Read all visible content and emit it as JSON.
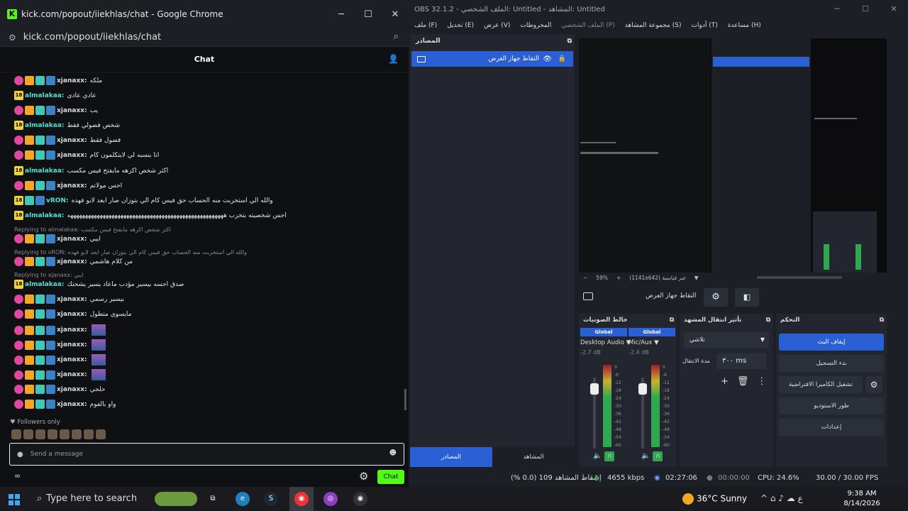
{
  "chrome": {
    "title": "kick.com/popout/iiekhlas/chat - Google Chrome",
    "url": "kick.com/popout/iiekhlas/chat",
    "chat_title": "Chat",
    "followers_only": "Followers only",
    "send_placeholder": "Send a message",
    "infinity": "∞",
    "chat_button": "Chat",
    "icons": {
      "logo": "kick-logo-icon",
      "minimize": "minimize-icon",
      "maximize": "maximize-icon",
      "close": "close-icon",
      "tune": "site-settings-icon",
      "zoom": "zoom-icon",
      "users": "user-list-icon",
      "gear": "gear-icon",
      "emoji": "emoji-icon"
    }
  },
  "messages": [
    {
      "user": "xjanaxx",
      "text": "ملكه"
    },
    {
      "user": "almalakaa",
      "text": "عادي عادي"
    },
    {
      "user": "xjanaxx",
      "text": "يب"
    },
    {
      "user": "almalakaa",
      "text": "شخص فضولي فقط"
    },
    {
      "user": "xjanaxx",
      "text": "فضول فقط"
    },
    {
      "user": "xjanaxx",
      "text": "انا بنسبه لي لايتكلمون كام"
    },
    {
      "user": "almalakaa",
      "text": "اكثر شخص اكرهه مايفتح فيس مكسب"
    },
    {
      "user": "xjanaxx",
      "text": "احس مولاتم"
    },
    {
      "user": "vRON",
      "text": "والله الي استخربت منه الحساب حق فيس كام الي بتوزان صار ابعد لابو فهده"
    },
    {
      "user": "almalakaa",
      "text": "احس شخصيته بتخرب هههههههههههههههههههههههههههههههههههههههههههههههههههههه"
    },
    {
      "reply": "Replying to almalakaa: اكثر شخص اكرهه مايفتح فيس مكسب",
      "user": "xjanaxx",
      "text": "ايبي"
    },
    {
      "reply": "Replying to vRON: والله الي استخربت منه الحساب حق فيس كام الي بتوزان صار ابعد لابو فهده",
      "user": "xjanaxx",
      "text": "من كلام هاشمي"
    },
    {
      "reply": "Replying to xjanaxx: ايبي",
      "user": "almalakaa",
      "text": "صدق احسه بيسير مؤدب ماعاد يسير يشحتك"
    },
    {
      "user": "xjanaxx",
      "text": "بيسير رسمي"
    },
    {
      "user": "xjanaxx",
      "text": "مايسوي متطول"
    },
    {
      "user": "xjanaxx",
      "text": ""
    },
    {
      "user": "xjanaxx",
      "text": ""
    },
    {
      "user": "xjanaxx",
      "text": ""
    },
    {
      "user": "xjanaxx",
      "text": ""
    },
    {
      "user": "xjanaxx",
      "text": "حلجي"
    },
    {
      "user": "xjanaxx",
      "text": "واو بالفوم"
    }
  ],
  "obs": {
    "title": "OBS 32.1.2 - الملف الشخصي: Untitled - المشاهد: Untitled",
    "menu": [
      "ملف (F)",
      "تحديل (E)",
      "عرض (V)",
      "المخروطات",
      "الملف الشخصي (P)",
      "مجموعة المشاهد (S)",
      "أدوات (T)",
      "مساعدة (H)"
    ],
    "sources_title": "المصادر",
    "source_name": "التقاط جهاز العرض",
    "preview_bar": {
      "zoom": "59%",
      "size": "(1141x642) غير قياسية"
    },
    "ctrl_source": "التقاط جهاز العرض",
    "mixer_title": "خالط الصوتيات",
    "channels": [
      {
        "tag": "Global",
        "name": "Desktop Audio",
        "db": "-2.7 dB",
        "level": 0.7
      },
      {
        "tag": "Global",
        "name": "Mic/Aux",
        "db": "-2.4 dB",
        "level": 0.75
      }
    ],
    "scale": [
      "0",
      "-6",
      "-12",
      "-18",
      "-24",
      "-30",
      "-36",
      "-42",
      "-48",
      "-54",
      "-60"
    ],
    "trans_title": "تأثير انتقال المشهد",
    "trans_select": "تلاشي",
    "trans_duration_label": "مدة الانتقال",
    "trans_duration": "٣٠٠ ms",
    "controls_title": "التحكم",
    "controls": [
      "إيقاف البث",
      "بدء التسجيل",
      "تشغيل الكاميرا الافتراضية",
      "طور الاستوديو",
      "إعدادات"
    ],
    "tabs": [
      "المصادر",
      "المشاهد"
    ],
    "status": {
      "dropped": "إسقاط المشاهد 109 (0.0 %)",
      "bitrate": "4655 kbps",
      "live": "02:27:06",
      "rec": "00:00:00",
      "cpu": "CPU: 24.6%",
      "fps": "30.00 / 30.00 FPS"
    },
    "icons": {
      "popout": "popout-icon",
      "monitor": "monitor-icon",
      "eye": "eye-icon",
      "lock": "lock-icon",
      "gear": "gear-icon",
      "filter": "filter-icon",
      "headphones": "headphones-icon",
      "speaker": "speaker-icon",
      "plus": "plus-icon",
      "trash": "trash-icon",
      "more": "more-icon"
    }
  },
  "taskbar": {
    "search": "Type here to search",
    "weather": "36°C  Sunny",
    "time": "9:38 AM",
    "date": "8/14/2026",
    "lang": "ع"
  },
  "colors": {
    "kick_green": "#53fc18",
    "obs_blue": "#2a5fd6",
    "mod_pink": "#e0479e",
    "sub_gold": "#f5a623",
    "vip_teal": "#40c7b6",
    "og_blue": "#3b82c4",
    "founder_yellow": "#f0d33b"
  }
}
